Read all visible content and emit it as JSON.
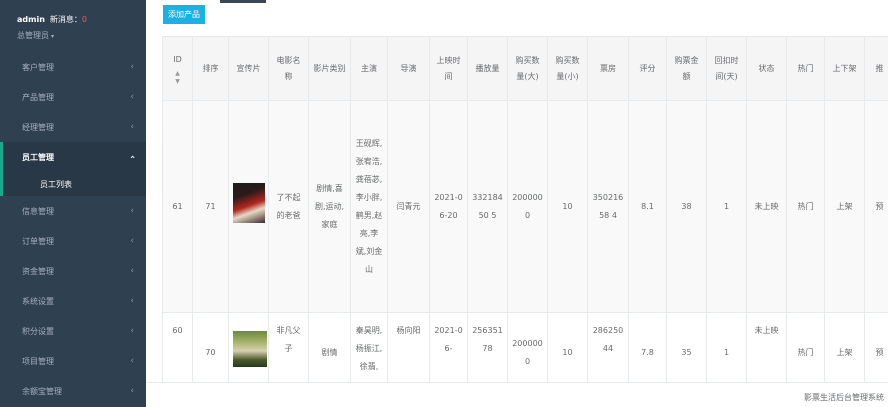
{
  "user": {
    "name": "admin",
    "notice_label": "新消息：",
    "notice_count": "0",
    "role": "总管理员",
    "role_caret": "▾"
  },
  "sidebar": {
    "items": [
      {
        "label": "客户管理"
      },
      {
        "label": "产品管理"
      },
      {
        "label": "经理管理"
      },
      {
        "label": "员工管理",
        "active": true
      },
      {
        "label": "信息管理"
      },
      {
        "label": "订单管理"
      },
      {
        "label": "资金管理"
      },
      {
        "label": "系统设置"
      },
      {
        "label": "积分设置"
      },
      {
        "label": "项目管理"
      },
      {
        "label": "余额宝管理"
      }
    ],
    "submenu_label": "员工列表"
  },
  "toolbar": {
    "add_label": "添加产品"
  },
  "table": {
    "headers": [
      "ID",
      "排序",
      "宣传片",
      "电影名称",
      "影片类别",
      "主演",
      "导演",
      "上映时间",
      "播放量",
      "购买数量(大)",
      "购买数量(小)",
      "票房",
      "评分",
      "购票金额",
      "回扣时间(天)",
      "状态",
      "热门",
      "上下架",
      "推"
    ],
    "rows": [
      {
        "id": "61",
        "sort": "71",
        "name": "了不起的老爸",
        "category": "剧情,喜剧,运动,家庭",
        "actors": "王砚辉,张宥浩,龚蓓苾,李小胖,鹤男,赵亮,李斌,刘金山",
        "director": "闫青元",
        "release": "2021-06-20",
        "plays": "33218450 5",
        "buy_big": "2000000",
        "buy_small": "10",
        "box_office": "35021658 4",
        "rating": "8.1",
        "price": "38",
        "rebate_days": "1",
        "status": "未上映",
        "hot": "热门",
        "shelf": "上架",
        "extra": "预"
      },
      {
        "id": "60",
        "sort": "70",
        "name": "非凡父子",
        "category": "剧情",
        "actors": "秦昊明,杨振江,徐翡,",
        "director": "杨向阳",
        "release": "2021-06-",
        "plays": "25635178",
        "buy_big": "2000000",
        "buy_small": "10",
        "box_office": "28625044",
        "rating": "7.8",
        "price": "35",
        "rebate_days": "1",
        "status": "未上映",
        "hot": "热门",
        "shelf": "上架",
        "extra": "预"
      }
    ]
  },
  "footer": {
    "text": "影票生活后台管理系统"
  },
  "icons": {
    "chevron": "chevron-left-icon",
    "sort": "sort-icon"
  },
  "colors": {
    "sidebar": "#2f4050",
    "accent": "#19aa8d",
    "button": "#1ab0e8",
    "notice": "#ed5565"
  }
}
